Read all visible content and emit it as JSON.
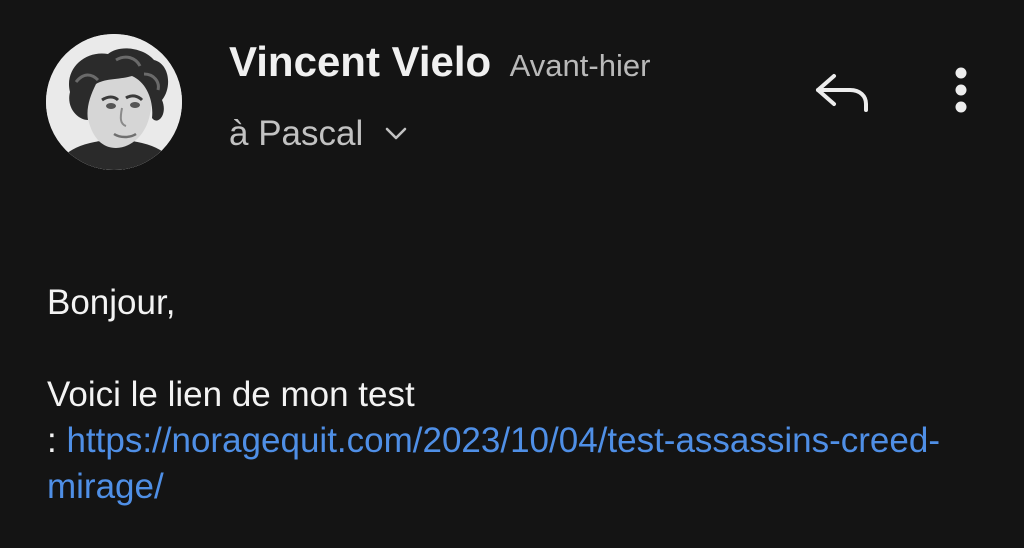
{
  "header": {
    "sender_name": "Vincent Vielo",
    "date": "Avant-hier",
    "recipient": "à Pascal"
  },
  "actions": {
    "reply_icon": "reply-icon",
    "more_icon": "more-vert-icon",
    "expand_icon": "chevron-down-icon"
  },
  "body": {
    "greeting": "Bonjour,",
    "line1": "Voici le lien de mon test",
    "line2_prefix": ": ",
    "link_text": "https://noragequit.com/2023/10/04/test-assassins-creed-mirage/"
  },
  "colors": {
    "background": "#141414",
    "link": "#4f8fe6",
    "secondary_text": "#b9b9b9"
  }
}
